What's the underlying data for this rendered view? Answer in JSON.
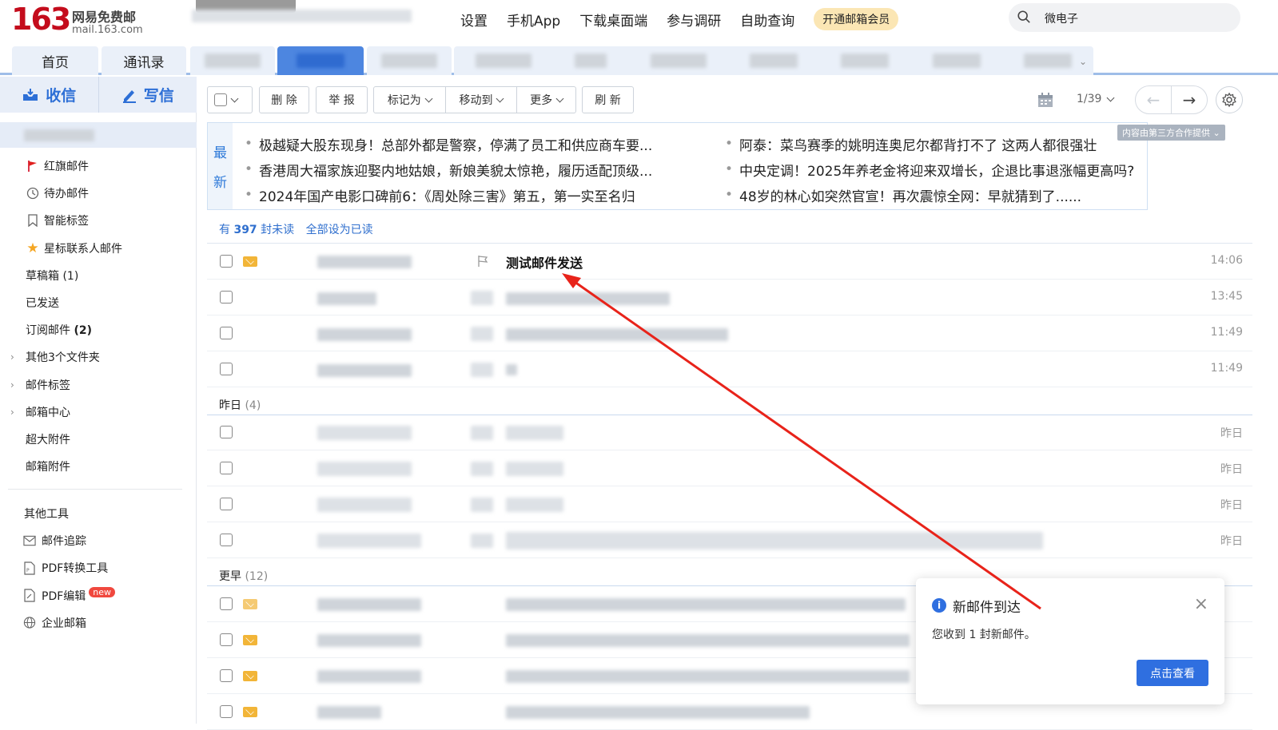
{
  "brand": {
    "logo_num": "163",
    "logo_cn": "网易免费邮",
    "logo_url": "mail.163.com",
    "color": "#c40c1c"
  },
  "top_nav": {
    "settings": "设置",
    "mobile_app": "手机App",
    "desktop": "下载桌面端",
    "survey": "参与调研",
    "self_query": "自助查询",
    "vip": "开通邮箱会员"
  },
  "search": {
    "value": "微电子",
    "icon": "search-icon"
  },
  "tabs": {
    "home": "首页",
    "contacts": "通讯录"
  },
  "left": {
    "receive": "收信",
    "compose": "写信",
    "menu": [
      {
        "label": "红旗邮件",
        "icon": "red-flag-icon"
      },
      {
        "label": "待办邮件",
        "icon": "clock-icon"
      },
      {
        "label": "智能标签",
        "icon": "bookmark-icon"
      },
      {
        "label": "星标联系人邮件",
        "icon": "star-icon"
      },
      {
        "label": "草稿箱 (1)"
      },
      {
        "label": "已发送"
      },
      {
        "label": "订阅邮件 ",
        "count": "(2)"
      },
      {
        "label": "其他3个文件夹",
        "expandable": true
      },
      {
        "label": "邮件标签",
        "expandable": true
      },
      {
        "label": "邮箱中心",
        "expandable": true
      },
      {
        "label": "超大附件"
      },
      {
        "label": "邮箱附件"
      }
    ],
    "tools_title": "其他工具",
    "tools": [
      {
        "label": "邮件追踪",
        "icon": "mail-track-icon"
      },
      {
        "label": "PDF转换工具",
        "icon": "pdf-icon"
      },
      {
        "label": "PDF编辑",
        "icon": "pdf-edit-icon",
        "badge": "new"
      },
      {
        "label": "企业邮箱",
        "icon": "globe-icon"
      }
    ]
  },
  "toolbar": {
    "delete": "删 除",
    "report": "举 报",
    "mark_as": "标记为",
    "move_to": "移动到",
    "more": "更多",
    "refresh": "刷 新",
    "page": "1/39"
  },
  "news": {
    "label_top": "最",
    "label_bottom": "新",
    "left": [
      "极越疑大股东现身！总部外都是警察，停满了员工和供应商车要...",
      "香港周大福家族迎娶内地姑娘，新娘美貌太惊艳，履历适配顶级...",
      "2024年国产电影口碑前6：《周处除三害》第五，第一实至名归"
    ],
    "right": [
      "阿泰：菜鸟赛季的姚明连奥尼尔都背打不了 这两人都很强壮",
      "中央定调！2025年养老金将迎来双增长，企退比事退涨幅更高吗?",
      "48岁的林心如突然官宣！再次震惊全网：早就猜到了......"
    ],
    "ad_tag": "内容由第三方合作提供"
  },
  "unread": {
    "prefix": "有 ",
    "count": "397",
    "suffix": " 封未读",
    "mark_all": "全部设为已读"
  },
  "groups": {
    "yesterday": "昨日",
    "yesterday_count": "(4)",
    "earlier": "更早",
    "earlier_count": "(12)"
  },
  "mail_today": [
    {
      "subject": "测试邮件发送",
      "time": "14:06",
      "unread": true
    },
    {
      "subject": "",
      "time": "13:45"
    },
    {
      "subject": "",
      "time": "11:49"
    },
    {
      "subject": "",
      "time": "11:49"
    }
  ],
  "mail_yesterday": [
    {
      "time": "昨日"
    },
    {
      "time": "昨日"
    },
    {
      "time": "昨日"
    },
    {
      "time": "昨日"
    }
  ],
  "toast": {
    "title": "新邮件到达",
    "message": "您收到 1 封新邮件。",
    "button": "点击查看",
    "close": "×"
  },
  "annotation": {
    "color": "#e8231a"
  }
}
